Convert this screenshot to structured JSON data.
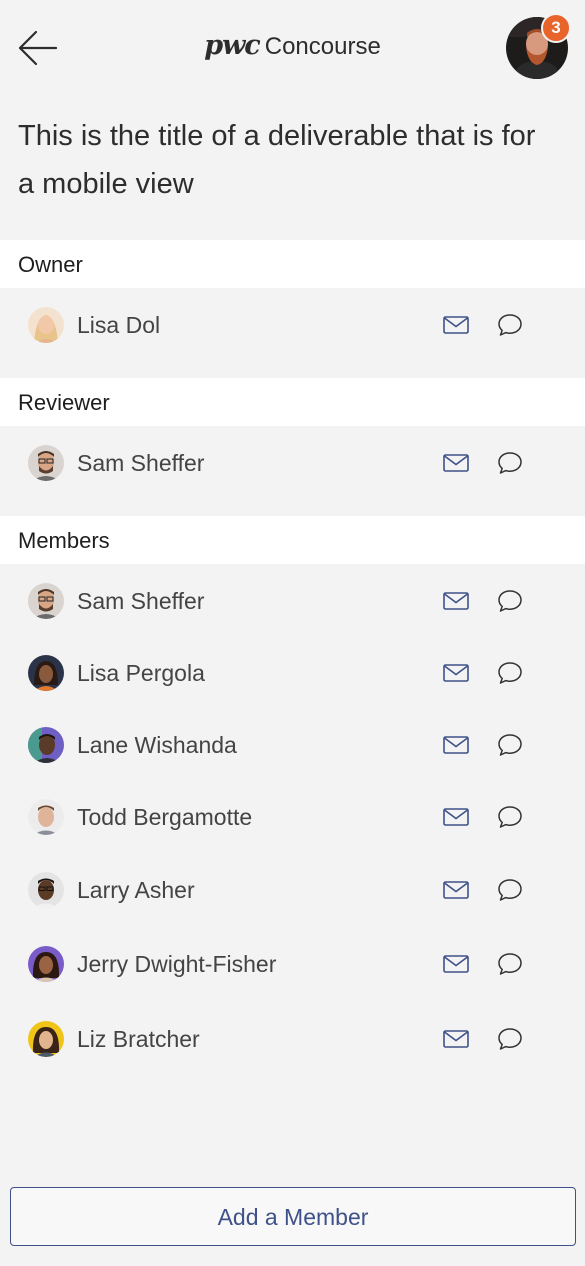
{
  "header": {
    "brand": "pwc",
    "product": "Concourse",
    "notification_count": "3",
    "back_icon": "arrow-left-icon",
    "profile_icon": "user-avatar"
  },
  "title": "This is the title of a deliverable that is for a mobile view",
  "sections": {
    "owner": {
      "label": "Owner",
      "people": [
        {
          "name": "Lisa Dol"
        }
      ]
    },
    "reviewer": {
      "label": "Reviewer",
      "people": [
        {
          "name": "Sam Sheffer"
        }
      ]
    },
    "members": {
      "label": "Members",
      "people": [
        {
          "name": "Sam Sheffer"
        },
        {
          "name": "Lisa Pergola"
        },
        {
          "name": "Lane Wishanda"
        },
        {
          "name": "Todd Bergamotte"
        },
        {
          "name": "Larry Asher"
        },
        {
          "name": "Jerry Dwight-Fisher"
        },
        {
          "name": "Liz Bratcher"
        }
      ]
    }
  },
  "row_icons": {
    "mail": "mail-icon",
    "chat": "chat-bubble-icon"
  },
  "actions": {
    "add_member": "Add a Member"
  },
  "colors": {
    "accent": "#3f5188",
    "badge": "#e8642a",
    "background": "#f3f3f3"
  }
}
